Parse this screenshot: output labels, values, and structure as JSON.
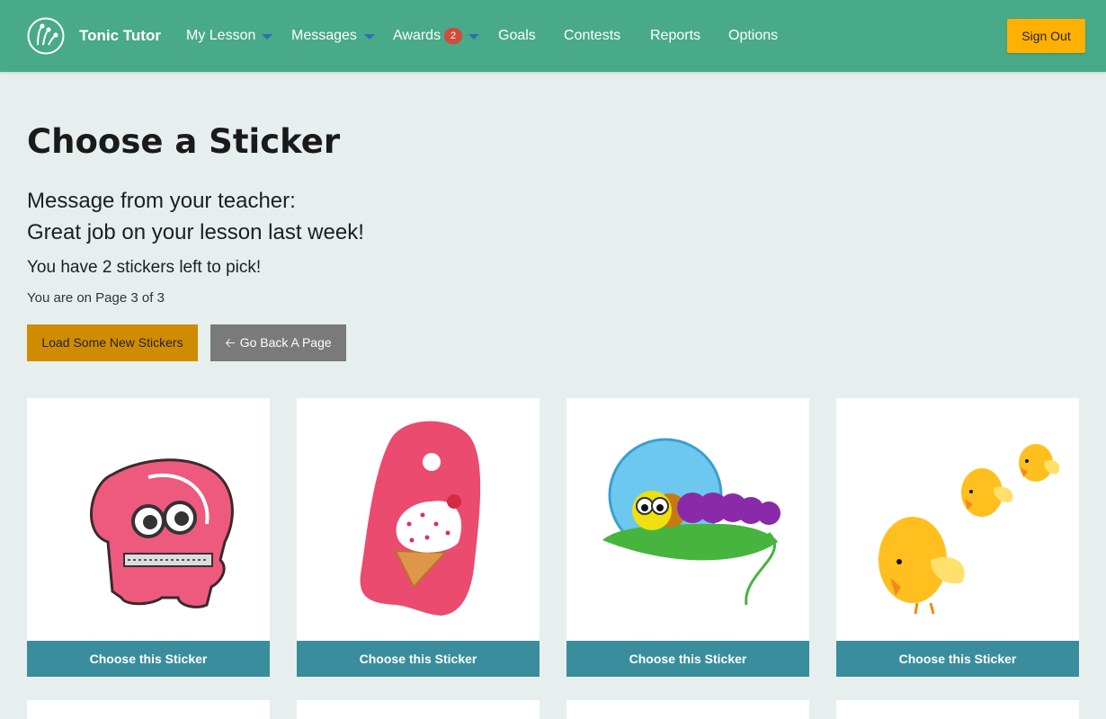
{
  "nav": {
    "brand": "Tonic Tutor",
    "items": [
      {
        "label": "My Lesson"
      },
      {
        "label": "Messages"
      },
      {
        "label": "Awards",
        "badge": "2"
      },
      {
        "label": "Goals"
      },
      {
        "label": "Contests"
      },
      {
        "label": "Reports"
      },
      {
        "label": "Options"
      }
    ],
    "sign_out": "Sign Out"
  },
  "main": {
    "title": "Choose a Sticker",
    "message_line1": "Message from your teacher:",
    "message_line2": "Great job on your lesson last week!",
    "stickers_left": "You have 2 stickers left to pick!",
    "page_info": "You are on Page 3 of 3",
    "load_button": "Load Some New Stickers",
    "back_button": "Go Back A Page"
  },
  "stickers": [
    {
      "name": "pink-monster-sticker",
      "button": "Choose this Sticker"
    },
    {
      "name": "ice-cream-tag-sticker",
      "button": "Choose this Sticker"
    },
    {
      "name": "caterpillar-sticker",
      "button": "Choose this Sticker"
    },
    {
      "name": "chicks-sticker",
      "button": "Choose this Sticker"
    }
  ],
  "colors": {
    "navbar": "#48aa88",
    "accent": "#ffb000",
    "load_button": "#d08c00",
    "choose_button": "#3a8d9c",
    "badge": "#d44a3a"
  }
}
